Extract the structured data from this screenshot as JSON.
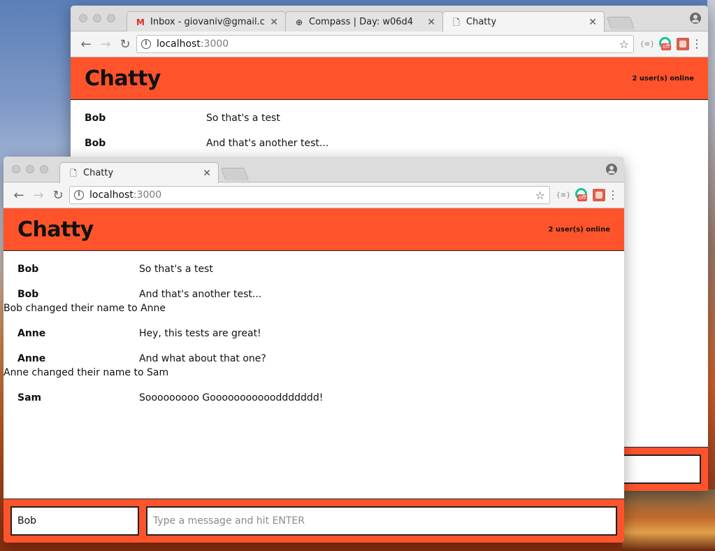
{
  "back_window": {
    "tabs": [
      {
        "label": "Inbox - giovaniv@gmail.com - G",
        "icon": "gmail-icon"
      },
      {
        "label": "Compass | Day: w06d4",
        "icon": "compass-icon"
      },
      {
        "label": "Chatty",
        "icon": "document-icon"
      }
    ],
    "url_host": "localhost",
    "url_port": ":3000",
    "app": {
      "brand": "Chatty",
      "users_online": "2 user(s) online",
      "messages": [
        {
          "user": "Bob",
          "content": "So that's a test"
        },
        {
          "user": "Bob",
          "content": "And that's another test..."
        }
      ]
    }
  },
  "front_window": {
    "tabs": [
      {
        "label": "Chatty",
        "icon": "document-icon"
      }
    ],
    "url_host": "localhost",
    "url_port": ":3000",
    "app": {
      "brand": "Chatty",
      "users_online": "2 user(s) online",
      "messages": [
        {
          "user": "Bob",
          "content": "So that's a test"
        },
        {
          "user": "Bob",
          "content": "And that's another test..."
        }
      ],
      "notice_1": "Bob changed their name to Anne",
      "messages_2": [
        {
          "user": "Anne",
          "content": "Hey, this tests are great!"
        },
        {
          "user": "Anne",
          "content": "And what about that one?"
        }
      ],
      "notice_2": "Anne changed their name to Sam",
      "messages_3": [
        {
          "user": "Sam",
          "content": "Sooooooooo Goooooooooooddddddd!"
        }
      ],
      "username_value": "Bob",
      "message_placeholder": "Type a message and hit ENTER"
    }
  },
  "colors": {
    "accent": "#ff542b",
    "gmail_red": "#d93025",
    "grammarly_green": "#15c39a"
  }
}
